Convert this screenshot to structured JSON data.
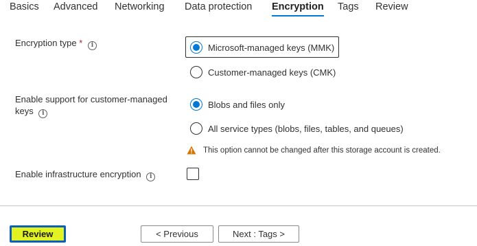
{
  "tabs": [
    "Basics",
    "Advanced",
    "Networking",
    "Data protection",
    "Encryption",
    "Tags",
    "Review"
  ],
  "active_tab": "Encryption",
  "encryption_type": {
    "label": "Encryption type",
    "required_mark": "*",
    "options": [
      "Microsoft-managed keys (MMK)",
      "Customer-managed keys (CMK)"
    ],
    "selected": "Microsoft-managed keys (MMK)"
  },
  "cmk_support": {
    "label_line1": "Enable support for customer-managed",
    "label_line2": "keys",
    "options": [
      "Blobs and files only",
      "All service types (blobs, files, tables, and queues)"
    ],
    "selected": "Blobs and files only",
    "warning": "This option cannot be changed after this storage account is created."
  },
  "infrastructure_encryption": {
    "label": "Enable infrastructure encryption",
    "checked": false
  },
  "footer": {
    "review_label": "Review",
    "previous_label": "< Previous",
    "next_label": "Next : Tags >"
  },
  "colors": {
    "accent": "#0078d4",
    "review_highlight": "#e3f221",
    "warning": "#d47500"
  },
  "icons": {
    "info": "info-icon",
    "warning": "warning-icon"
  }
}
